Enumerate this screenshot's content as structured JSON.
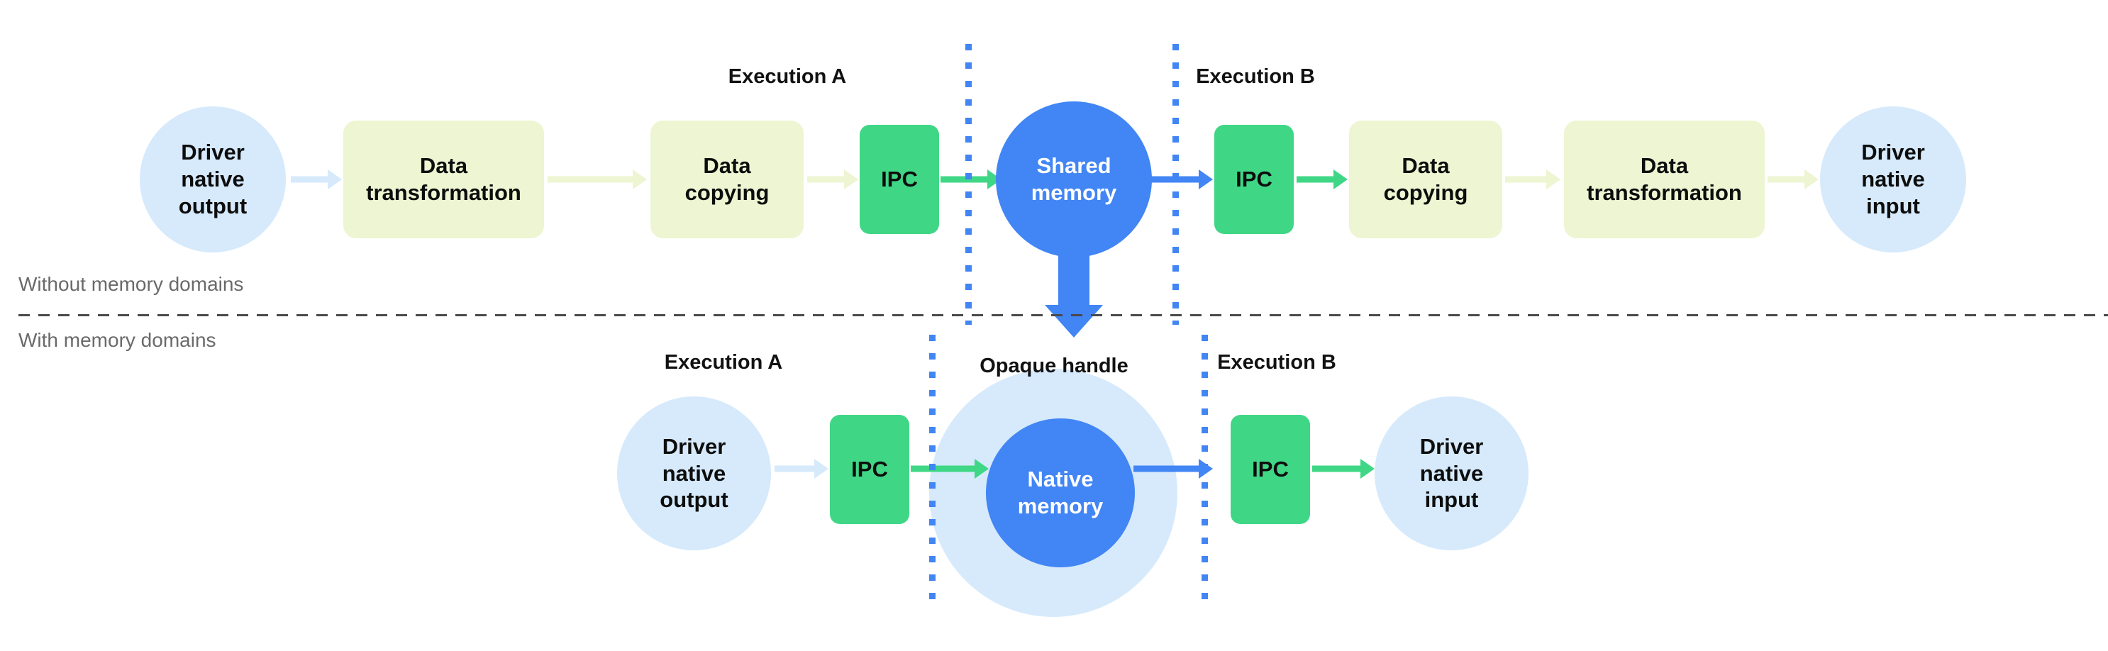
{
  "colors": {
    "light_blue": "#d6eafc",
    "blue": "#4285f4",
    "green": "#3fd786",
    "yellow_green": "#edf5d2",
    "divider_gray": "#4a4a4a",
    "side_label_gray": "#6a6a6a",
    "text_dark": "#0d0d0d",
    "white": "#ffffff"
  },
  "side_labels": {
    "without": "Without memory domains",
    "with": "With memory domains"
  },
  "top_row": {
    "execution_a_label": "Execution A",
    "execution_b_label": "Execution B",
    "nodes": {
      "driver_native_output": "Driver\nnative\noutput",
      "data_transformation_left": "Data\ntransformation",
      "data_copying_left": "Data\ncopying",
      "ipc_left": "IPC",
      "shared_memory": "Shared\nmemory",
      "ipc_right": "IPC",
      "data_copying_right": "Data\ncopying",
      "data_transformation_right": "Data\ntransformation",
      "driver_native_input": "Driver\nnative\ninput"
    }
  },
  "bottom_row": {
    "execution_a_label": "Execution A",
    "execution_b_label": "Execution B",
    "opaque_handle_label": "Opaque handle",
    "nodes": {
      "driver_native_output": "Driver\nnative\noutput",
      "ipc_left": "IPC",
      "native_memory": "Native\nmemory",
      "ipc_right": "IPC",
      "driver_native_input": "Driver\nnative\ninput"
    }
  }
}
